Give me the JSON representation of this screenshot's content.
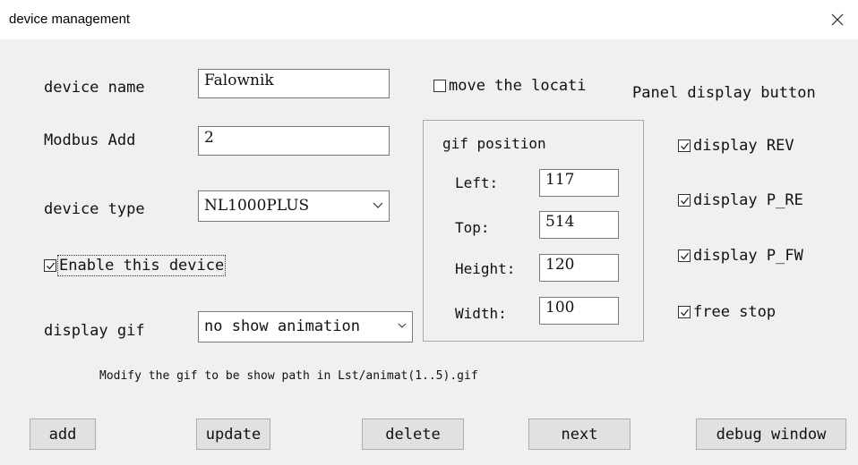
{
  "window": {
    "title": "device management"
  },
  "form": {
    "device_name_label": "device name",
    "device_name_value": "Falownik",
    "modbus_label": "Modbus Add",
    "modbus_value": "2",
    "device_type_label": "device type",
    "device_type_value": "NL1000PLUS",
    "enable_label": "Enable this device",
    "enable_checked": true,
    "display_gif_label": "display gif",
    "display_gif_value": "no show animation",
    "move_location_label": "move the locati",
    "move_location_checked": false
  },
  "gif_position": {
    "title": "gif position",
    "left_label": "Left:",
    "left_value": "117",
    "top_label": "Top:",
    "top_value": "514",
    "height_label": "Height:",
    "height_value": "120",
    "width_label": "Width:",
    "width_value": "100"
  },
  "panel": {
    "title": "Panel display button",
    "items": [
      {
        "label": "display REV",
        "checked": true
      },
      {
        "label": "display P_RE",
        "checked": true
      },
      {
        "label": "display P_FW",
        "checked": true
      },
      {
        "label": "free stop",
        "checked": true
      }
    ]
  },
  "hint": "Modify the gif to be show path in  Lst/animat(1..5).gif",
  "buttons": {
    "add": "add",
    "update": "update",
    "delete": "delete",
    "next": "next",
    "debug": "debug window"
  }
}
